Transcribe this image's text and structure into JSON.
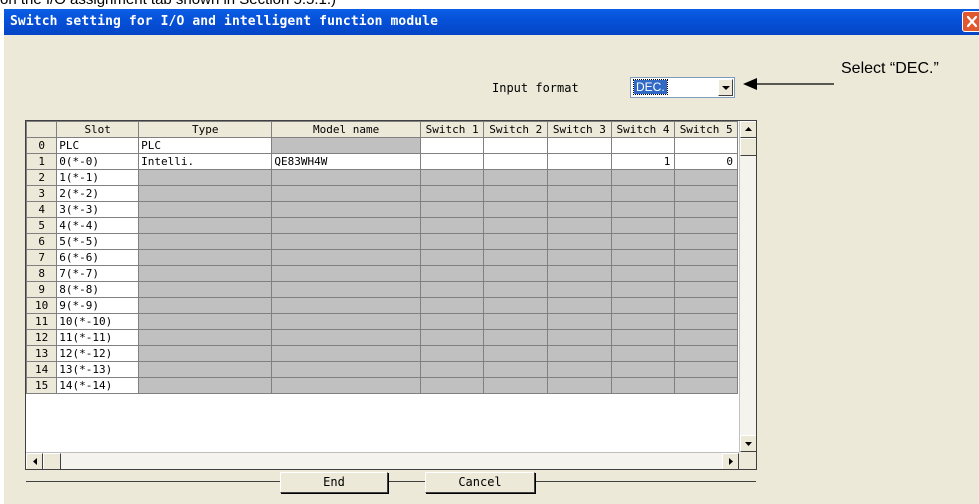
{
  "caption_top": "on the I/O assignment tab shown in Section 5.5.1.)",
  "dialog": {
    "title": "Switch setting for I/O and intelligent function module",
    "close_glyph": "×"
  },
  "input_format": {
    "label": "Input format",
    "value": "DEC."
  },
  "annotation": {
    "text": "Select “DEC.”"
  },
  "table": {
    "columns": [
      "Slot",
      "Type",
      "Model name",
      "Switch 1",
      "Switch 2",
      "Switch 3",
      "Switch 4",
      "Switch 5"
    ],
    "rows": [
      {
        "num": "0",
        "slot": "PLC",
        "type": "PLC",
        "model": "",
        "switches": [
          "",
          "",
          "",
          "",
          ""
        ]
      },
      {
        "num": "1",
        "slot": "0(*-0)",
        "type": "Intelli.",
        "model": "QE83WH4W",
        "switches": [
          "",
          "",
          "",
          "1",
          "0"
        ]
      },
      {
        "num": "2",
        "slot": "1(*-1)",
        "type": "",
        "model": "",
        "switches": [
          "",
          "",
          "",
          "",
          ""
        ]
      },
      {
        "num": "3",
        "slot": "2(*-2)",
        "type": "",
        "model": "",
        "switches": [
          "",
          "",
          "",
          "",
          ""
        ]
      },
      {
        "num": "4",
        "slot": "3(*-3)",
        "type": "",
        "model": "",
        "switches": [
          "",
          "",
          "",
          "",
          ""
        ]
      },
      {
        "num": "5",
        "slot": "4(*-4)",
        "type": "",
        "model": "",
        "switches": [
          "",
          "",
          "",
          "",
          ""
        ]
      },
      {
        "num": "6",
        "slot": "5(*-5)",
        "type": "",
        "model": "",
        "switches": [
          "",
          "",
          "",
          "",
          ""
        ]
      },
      {
        "num": "7",
        "slot": "6(*-6)",
        "type": "",
        "model": "",
        "switches": [
          "",
          "",
          "",
          "",
          ""
        ]
      },
      {
        "num": "8",
        "slot": "7(*-7)",
        "type": "",
        "model": "",
        "switches": [
          "",
          "",
          "",
          "",
          ""
        ]
      },
      {
        "num": "9",
        "slot": "8(*-8)",
        "type": "",
        "model": "",
        "switches": [
          "",
          "",
          "",
          "",
          ""
        ]
      },
      {
        "num": "10",
        "slot": "9(*-9)",
        "type": "",
        "model": "",
        "switches": [
          "",
          "",
          "",
          "",
          ""
        ]
      },
      {
        "num": "11",
        "slot": "10(*-10)",
        "type": "",
        "model": "",
        "switches": [
          "",
          "",
          "",
          "",
          ""
        ]
      },
      {
        "num": "12",
        "slot": "11(*-11)",
        "type": "",
        "model": "",
        "switches": [
          "",
          "",
          "",
          "",
          ""
        ]
      },
      {
        "num": "13",
        "slot": "12(*-12)",
        "type": "",
        "model": "",
        "switches": [
          "",
          "",
          "",
          "",
          ""
        ]
      },
      {
        "num": "14",
        "slot": "13(*-13)",
        "type": "",
        "model": "",
        "switches": [
          "",
          "",
          "",
          "",
          ""
        ]
      },
      {
        "num": "15",
        "slot": "14(*-14)",
        "type": "",
        "model": "",
        "switches": [
          "",
          "",
          "",
          "",
          ""
        ]
      }
    ]
  },
  "buttons": {
    "end": "End",
    "cancel": "Cancel"
  },
  "colors": {
    "titlebar": "#0650d8",
    "dialog_bg": "#ece9d8",
    "selection": "#316ac5",
    "close_button": "#e0582e"
  }
}
